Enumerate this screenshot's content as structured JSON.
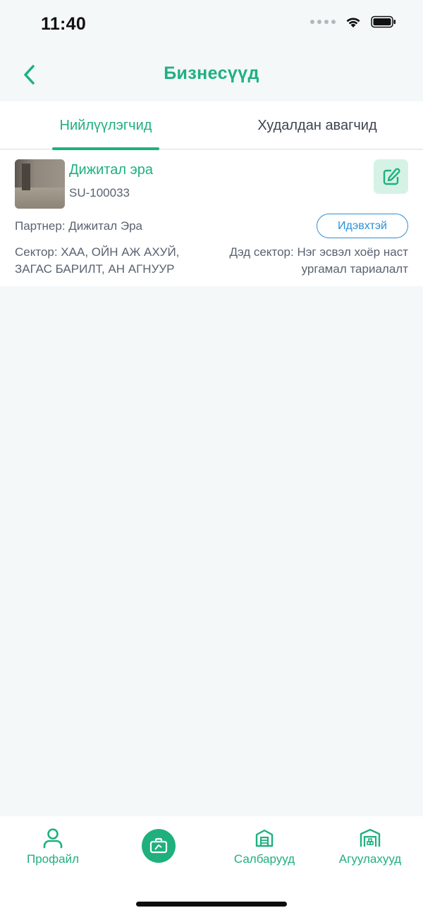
{
  "status_bar": {
    "time": "11:40"
  },
  "header": {
    "title": "Бизнесүүд"
  },
  "tabs": [
    {
      "label": "Нийлүүлэгчид",
      "active": true
    },
    {
      "label": "Худалдан авагчид",
      "active": false
    }
  ],
  "businesses": [
    {
      "name": "Дижитал эра",
      "code": "SU-100033",
      "partner": "Партнер: Дижитал Эра",
      "status": "Идэвхтэй",
      "sector": "Сектор: ХАА, ОЙН АЖ АХУЙ, ЗАГАС БАРИЛТ, АН АГНУУР",
      "subsector": "Дэд сектор: Нэг эсвэл хоёр наст ургамал тариалалт"
    }
  ],
  "bottom_nav": [
    {
      "label": "Профайл",
      "icon": "user-icon"
    },
    {
      "label": "",
      "icon": "briefcase-icon",
      "active": true
    },
    {
      "label": "Салбарууд",
      "icon": "branch-icon"
    },
    {
      "label": "Агуулахууд",
      "icon": "warehouse-icon"
    }
  ],
  "colors": {
    "accent": "#1fb07e",
    "status": "#2b8fd6",
    "background": "#f4f8f9"
  }
}
